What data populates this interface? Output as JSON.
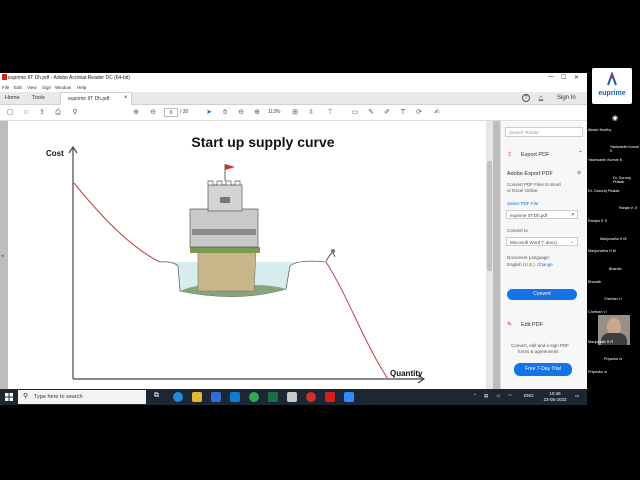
{
  "window": {
    "title": "euprime IIT Dh.pdf - Adobe Acrobat Reader DC (64-bit)",
    "menu": [
      "File",
      "Edit",
      "View",
      "Sign",
      "Window",
      "Help"
    ]
  },
  "tabs": {
    "home": "Home",
    "tools": "Tools",
    "document": "euprime IIT Dh.pdf",
    "help": "?",
    "sign_in": "Sign In"
  },
  "toolbar": {
    "page_current": "6",
    "page_total": "/ 30",
    "zoom": "113%"
  },
  "slide": {
    "title": "Start up supply curve",
    "y_axis_label": "Cost",
    "x_axis_label": "Quantity"
  },
  "pane": {
    "search_placeholder": "Search 'Rotate'",
    "export_header": "Export PDF",
    "export_title": "Adobe Export PDF",
    "export_desc_1": "Convert PDF Files to Word",
    "export_desc_2": "or Excel Online",
    "select_label": "Select PDF File",
    "selected_file": "euprime IIT Dh.pdf",
    "convert_to_label": "Convert to",
    "convert_to_value": "Microsoft Word (*.docx)",
    "doc_language_label": "Document Language:",
    "doc_language_value": "English (U.S.)",
    "change_link": "Change",
    "convert_button": "Convert",
    "edit_pdf": "Edit PDF",
    "promo_1": "Convert, edit and e-sign PDF",
    "promo_2": "forms & agreements",
    "trial_button": "Free 7-Day Trial"
  },
  "meeting": {
    "logo_text": "euprime",
    "participants": [
      "Akash Murthy",
      "Yashwanth Kumar K",
      "Yashwanth Kumar K",
      "Dr. Gururaj Phatak",
      "Dr. Gururaj Phatak",
      "Ranjan K S",
      "Ranjan K S",
      "Manjunatha H M",
      "Manjunatha H M",
      "Bharath",
      "Bharath",
      "Chethan v l",
      "Chethan v l",
      "Manjunath S R",
      "Priyanka m",
      "Priyanka m"
    ]
  },
  "taskbar": {
    "search_placeholder": "Type here to search",
    "language": "ENG",
    "time": "10:46",
    "date": "23-05-2022"
  }
}
